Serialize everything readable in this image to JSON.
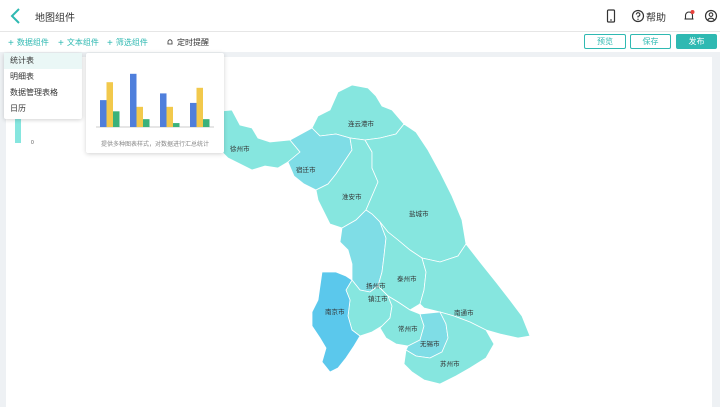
{
  "header": {
    "title": "地图组件",
    "help_label": "帮助"
  },
  "toolbar": {
    "data_component": "数据组件",
    "text_component": "文本组件",
    "filter_component": "筛选组件",
    "timer_reminder": "定时提醒",
    "preview_button": "预览",
    "save_button": "保存",
    "publish_button": "发布"
  },
  "dropdown": {
    "items": [
      "统计表",
      "明细表",
      "数据管理表格",
      "日历"
    ]
  },
  "preview_popup": {
    "caption": "提供多种图表样式，对数据进行汇总统计",
    "bars": [
      {
        "a": 0.48,
        "b": 0.8,
        "c": 0.28
      },
      {
        "a": 0.95,
        "b": 0.36,
        "c": 0.14
      },
      {
        "a": 0.6,
        "b": 0.36,
        "c": 0.07
      },
      {
        "a": 0.43,
        "b": 0.7,
        "c": 0.14
      }
    ],
    "colors": {
      "a": "#4f7fdc",
      "b": "#f2c94c",
      "c": "#3bb27a"
    }
  },
  "legend": {
    "min_label": "0"
  },
  "map": {
    "cities": [
      "连云港市",
      "徐州市",
      "宿迁市",
      "淮安市",
      "盐城市",
      "泰州市",
      "扬州市",
      "镇江市",
      "南京市",
      "常州市",
      "南通市",
      "无锡市",
      "苏州市"
    ],
    "colors": {
      "light": "#86e6df",
      "mid": "#7fdde6",
      "dark": "#5bc8ec",
      "border": "#ffffff"
    }
  },
  "accent_color": "#2fb9b2"
}
